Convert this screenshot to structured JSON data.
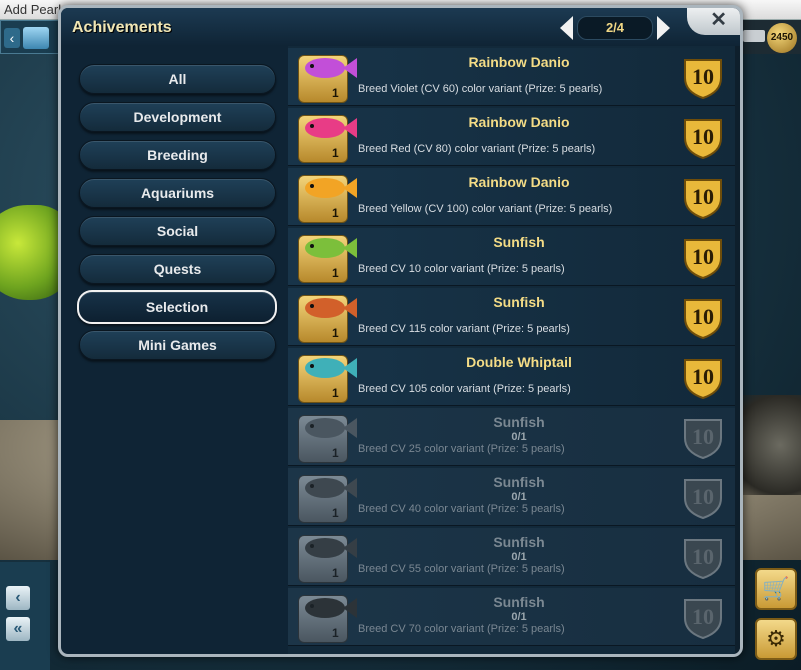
{
  "background": {
    "app_title": "Add Pearl",
    "pearl_count": "2450",
    "nav_back": "‹",
    "arrow_left": "«",
    "arrow_left_single": "‹",
    "shop_icon": "cart-icon",
    "settings_icon": "gear-icon",
    "counter_fragment": "2"
  },
  "modal": {
    "title": "Achivements",
    "pager": "2/4",
    "close_label": "✕"
  },
  "categories": [
    {
      "label": "All",
      "selected": false
    },
    {
      "label": "Development",
      "selected": false
    },
    {
      "label": "Breeding",
      "selected": false
    },
    {
      "label": "Aquariums",
      "selected": false
    },
    {
      "label": "Social",
      "selected": false
    },
    {
      "label": "Quests",
      "selected": false
    },
    {
      "label": "Selection",
      "selected": true
    },
    {
      "label": "Mini Games",
      "selected": false
    }
  ],
  "achievements": [
    {
      "title": "Rainbow Danio",
      "progress": "",
      "desc": "Breed Violet (CV 60) color variant (Prize: 5 pearls)",
      "count": "1",
      "reward": "10",
      "locked": false,
      "fish_color": "#c24fd8"
    },
    {
      "title": "Rainbow Danio",
      "progress": "",
      "desc": "Breed Red (CV 80) color variant (Prize: 5 pearls)",
      "count": "1",
      "reward": "10",
      "locked": false,
      "fish_color": "#e83c86"
    },
    {
      "title": "Rainbow Danio",
      "progress": "",
      "desc": "Breed Yellow (CV 100) color variant (Prize: 5 pearls)",
      "count": "1",
      "reward": "10",
      "locked": false,
      "fish_color": "#f2a425"
    },
    {
      "title": "Sunfish",
      "progress": "",
      "desc": "Breed CV 10 color variant (Prize: 5 pearls)",
      "count": "1",
      "reward": "10",
      "locked": false,
      "fish_color": "#7cbf3b"
    },
    {
      "title": "Sunfish",
      "progress": "",
      "desc": "Breed CV 115 color variant (Prize: 5 pearls)",
      "count": "1",
      "reward": "10",
      "locked": false,
      "fish_color": "#d2602a"
    },
    {
      "title": "Double Whiptail",
      "progress": "",
      "desc": "Breed CV 105 color variant (Prize: 5 pearls)",
      "count": "1",
      "reward": "10",
      "locked": false,
      "fish_color": "#3fb0b8"
    },
    {
      "title": "Sunfish",
      "progress": "0/1",
      "desc": "Breed CV 25 color variant (Prize: 5 pearls)",
      "count": "1",
      "reward": "10",
      "locked": true,
      "fish_color": "#4a5660"
    },
    {
      "title": "Sunfish",
      "progress": "0/1",
      "desc": "Breed CV 40 color variant (Prize: 5 pearls)",
      "count": "1",
      "reward": "10",
      "locked": true,
      "fish_color": "#3e4850"
    },
    {
      "title": "Sunfish",
      "progress": "0/1",
      "desc": "Breed CV 55 color variant (Prize: 5 pearls)",
      "count": "1",
      "reward": "10",
      "locked": true,
      "fish_color": "#353e45"
    },
    {
      "title": "Sunfish",
      "progress": "0/1",
      "desc": "Breed CV 70 color variant (Prize: 5 pearls)",
      "count": "1",
      "reward": "10",
      "locked": true,
      "fish_color": "#2c3338"
    }
  ]
}
